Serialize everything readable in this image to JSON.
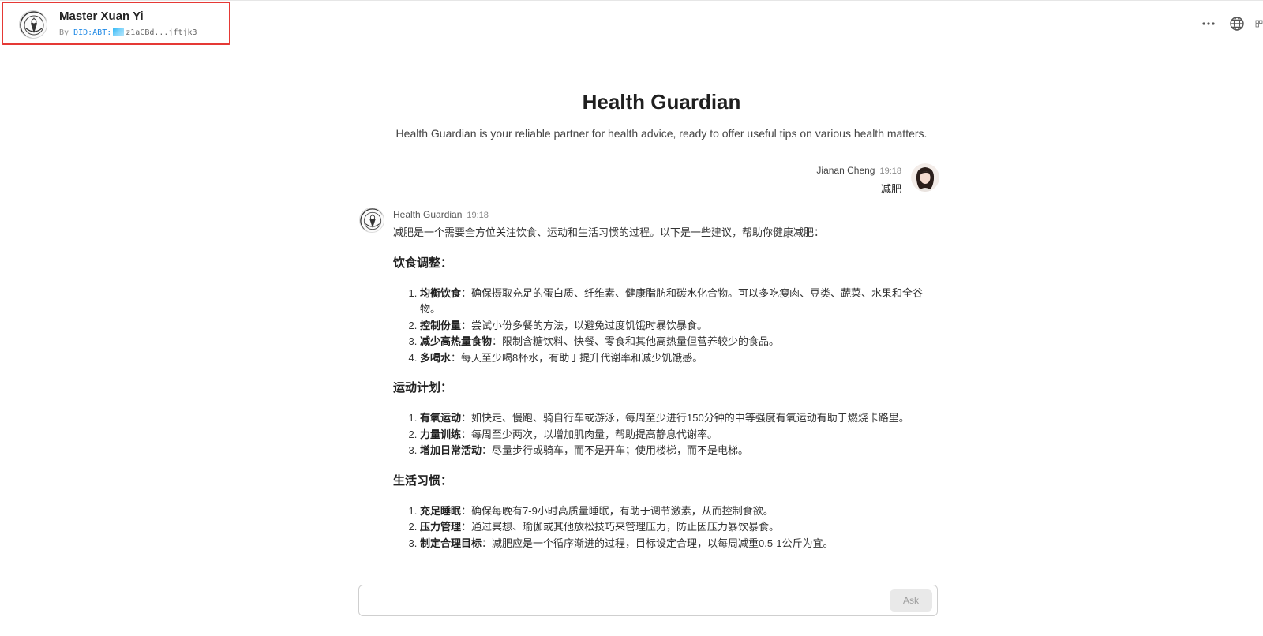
{
  "header": {
    "agent_name": "Master Xuan Yi",
    "by_label": "By",
    "did_prefix": "DID:ABT:",
    "did_address": "z1aCBd...jftjk3",
    "actions": [
      "more-icon",
      "globe-icon",
      "layout-icon"
    ]
  },
  "main": {
    "title": "Health Guardian",
    "description": "Health Guardian is your reliable partner for health advice, ready to offer useful tips on various health matters."
  },
  "user_message": {
    "author": "Jianan Cheng",
    "time": "19:18",
    "text": "减肥"
  },
  "bot_message": {
    "author": "Health Guardian",
    "time": "19:18",
    "intro": "减肥是一个需要全方位关注饮食、运动和生活习惯的过程。以下是一些建议，帮助你健康减肥：",
    "sections": [
      {
        "heading": "饮食调整：",
        "items": [
          {
            "title": "均衡饮食",
            "text": "：确保摄取充足的蛋白质、纤维素、健康脂肪和碳水化合物。可以多吃瘦肉、豆类、蔬菜、水果和全谷物。"
          },
          {
            "title": "控制份量",
            "text": "：尝试小份多餐的方法，以避免过度饥饿时暴饮暴食。"
          },
          {
            "title": "减少高热量食物",
            "text": "：限制含糖饮料、快餐、零食和其他高热量但营养较少的食品。"
          },
          {
            "title": "多喝水",
            "text": "：每天至少喝8杯水，有助于提升代谢率和减少饥饿感。"
          }
        ]
      },
      {
        "heading": "运动计划：",
        "items": [
          {
            "title": "有氧运动",
            "text": "：如快走、慢跑、骑自行车或游泳，每周至少进行150分钟的中等强度有氧运动有助于燃烧卡路里。"
          },
          {
            "title": "力量训练",
            "text": "：每周至少两次，以增加肌肉量，帮助提高静息代谢率。"
          },
          {
            "title": "增加日常活动",
            "text": "：尽量步行或骑车，而不是开车；使用楼梯，而不是电梯。"
          }
        ]
      },
      {
        "heading": "生活习惯：",
        "items": [
          {
            "title": "充足睡眠",
            "text": "：确保每晚有7-9小时高质量睡眠，有助于调节激素，从而控制食欲。"
          },
          {
            "title": "压力管理",
            "text": "：通过冥想、瑜伽或其他放松技巧来管理压力，防止因压力暴饮暴食。"
          },
          {
            "title": "制定合理目标",
            "text": "：减肥应是一个循序渐进的过程，目标设定合理，以每周减重0.5-1公斤为宜。"
          }
        ]
      }
    ]
  },
  "input": {
    "placeholder": "",
    "value": "",
    "ask_label": "Ask"
  }
}
